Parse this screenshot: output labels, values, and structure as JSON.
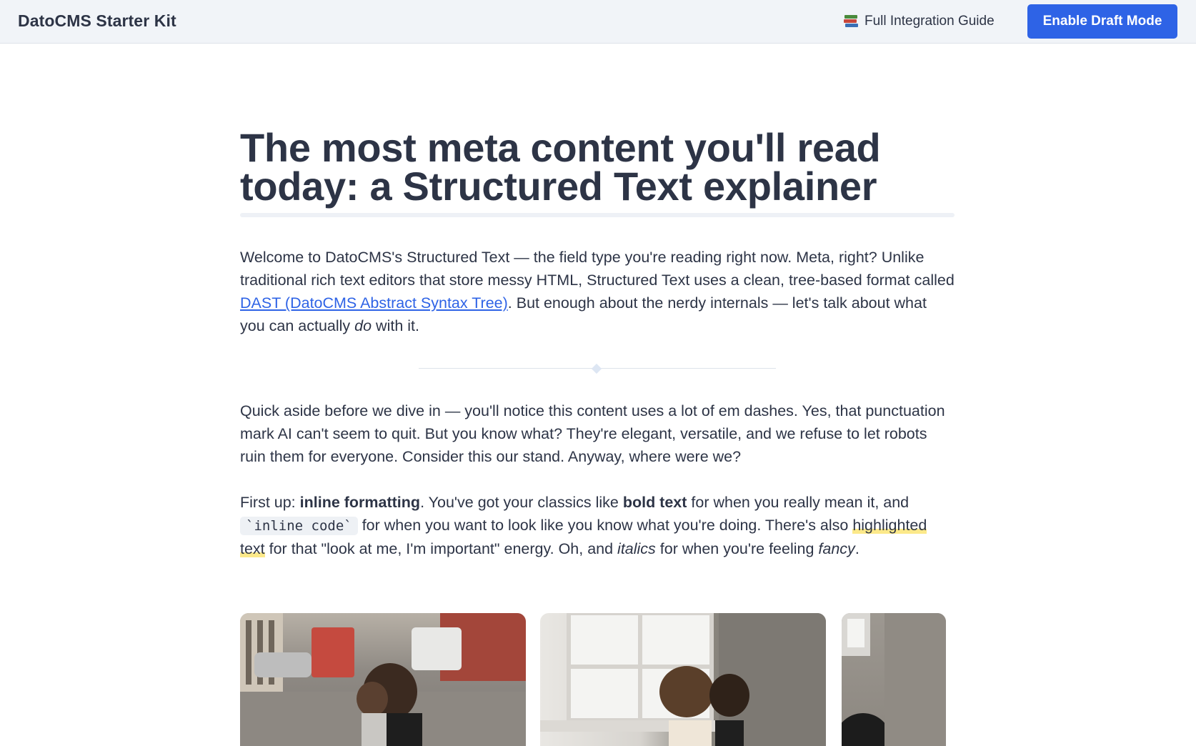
{
  "header": {
    "brand": "DatoCMS Starter Kit",
    "guide_link": "Full Integration Guide",
    "guide_icon": "books-icon",
    "draft_button": "Enable Draft Mode",
    "accent_color": "#2e63e6"
  },
  "article": {
    "title": "The most meta content you'll read today: a Structured Text explainer",
    "p1": {
      "t1": "Welcome to DatoCMS's Structured Text — the field type you're reading right now. Meta, right? Unlike traditional rich text editors that store messy HTML, Structured Text uses a clean, tree-based format called ",
      "link": "DAST (DatoCMS Abstract Syntax Tree)",
      "t2": ". But enough about the nerdy internals — let's talk about what you can actually ",
      "em": "do",
      "t3": " with it."
    },
    "p2": "Quick aside before we dive in — you'll notice this content uses a lot of em dashes. Yes, that punctuation mark AI can't seem to quit. But you know what? They're elegant, versatile, and we refuse to let robots ruin them for everyone. Consider this our stand. Anyway, where were we?",
    "p3": {
      "t1": "First up: ",
      "b1": "inline formatting",
      "t2": ". You've got your classics like ",
      "b2": "bold text",
      "t3": " for when you really mean it, and ",
      "code": "`inline code`",
      "t4": " for when you want to look like you know what you're doing. There's also ",
      "hl": "highlighted text",
      "t5": " for that \"look at me, I'm important\" energy. Oh, and ",
      "i1": "italics",
      "t6": " for when you're feeling ",
      "i2": "fancy",
      "t7": "."
    }
  }
}
